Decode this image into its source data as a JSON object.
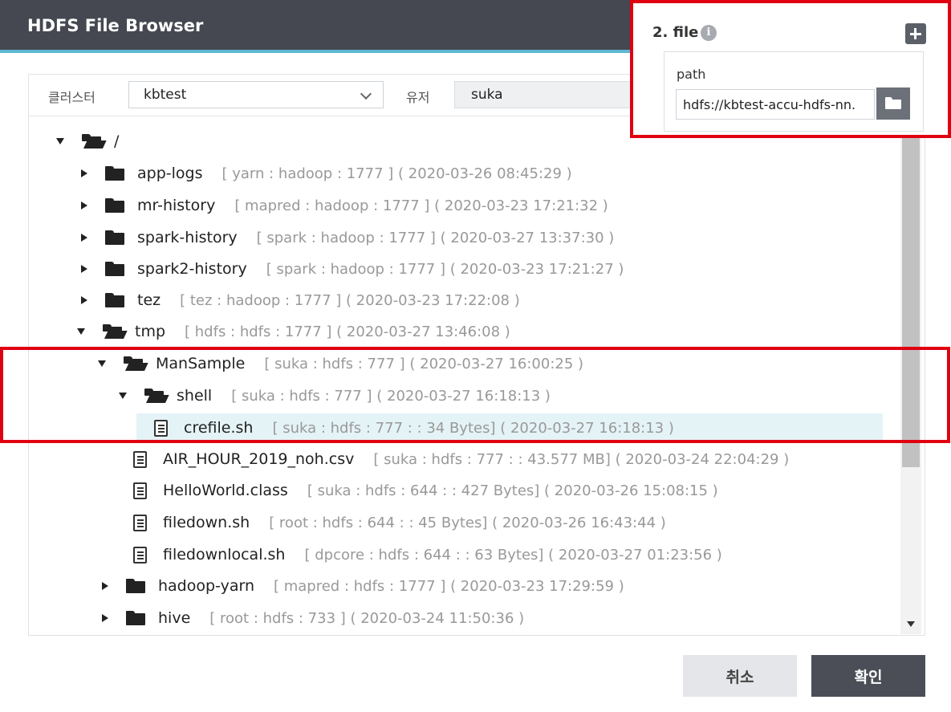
{
  "window": {
    "title": "HDFS File Browser"
  },
  "filters": {
    "cluster_label": "클러스터",
    "cluster_value": "kbtest",
    "user_label": "유저",
    "user_value": "suka"
  },
  "tree": {
    "root": {
      "name": "/"
    },
    "nodes": [
      {
        "name": "app-logs",
        "meta": "[ yarn : hadoop : 1777 ] ( 2020-03-26 08:45:29 )"
      },
      {
        "name": "mr-history",
        "meta": "[ mapred : hadoop : 1777 ] ( 2020-03-23 17:21:32 )"
      },
      {
        "name": "spark-history",
        "meta": "[ spark : hadoop : 1777 ] ( 2020-03-27 13:37:30 )"
      },
      {
        "name": "spark2-history",
        "meta": "[ spark : hadoop : 1777 ] ( 2020-03-23 17:21:27 )"
      },
      {
        "name": "tez",
        "meta": "[ tez : hadoop : 1777 ] ( 2020-03-23 17:22:08 )"
      },
      {
        "name": "tmp",
        "meta": "[ hdfs : hdfs : 1777 ] ( 2020-03-27 13:46:08 )"
      },
      {
        "name": "ManSample",
        "meta": "[ suka : hdfs : 777 ] ( 2020-03-27 16:00:25 )"
      },
      {
        "name": "shell",
        "meta": "[ suka : hdfs : 777 ] ( 2020-03-27 16:18:13 )"
      },
      {
        "name": "crefile.sh",
        "meta": "[ suka : hdfs : 777 : : 34 Bytes] ( 2020-03-27 16:18:13 )"
      },
      {
        "name": "AIR_HOUR_2019_noh.csv",
        "meta": "[ suka : hdfs : 777 : : 43.577 MB] ( 2020-03-24 22:04:29 )"
      },
      {
        "name": "HelloWorld.class",
        "meta": "[ suka : hdfs : 644 : : 427 Bytes] ( 2020-03-26 15:08:15 )"
      },
      {
        "name": "filedown.sh",
        "meta": "[ root : hdfs : 644 : : 45 Bytes] ( 2020-03-26 16:43:44 )"
      },
      {
        "name": "filedownlocal.sh",
        "meta": "[ dpcore : hdfs : 644 : : 63 Bytes] ( 2020-03-27 01:23:56 )"
      },
      {
        "name": "hadoop-yarn",
        "meta": "[ mapred : hdfs : 1777 ] ( 2020-03-23 17:29:59 )"
      },
      {
        "name": "hive",
        "meta": "[ root : hdfs : 733 ] ( 2020-03-24 11:50:36 )"
      }
    ]
  },
  "buttons": {
    "cancel": "취소",
    "confirm": "확인"
  },
  "file_setting": {
    "header": "2. file",
    "path_label": "path",
    "path_value": "hdfs://kbtest-accu-hdfs-nn."
  },
  "icons": {
    "folder": "folder-icon",
    "folder_open": "folder-open-icon",
    "file": "file-icon",
    "info": "info-icon",
    "add": "plus-icon",
    "chevron": "chevron-down-icon"
  },
  "colors": {
    "titlebar": "#454851",
    "accent_line": "#5fb8d0",
    "selected_row": "#e4f3f6",
    "highlight": "#e0000f",
    "confirm_button": "#4b4e56"
  }
}
